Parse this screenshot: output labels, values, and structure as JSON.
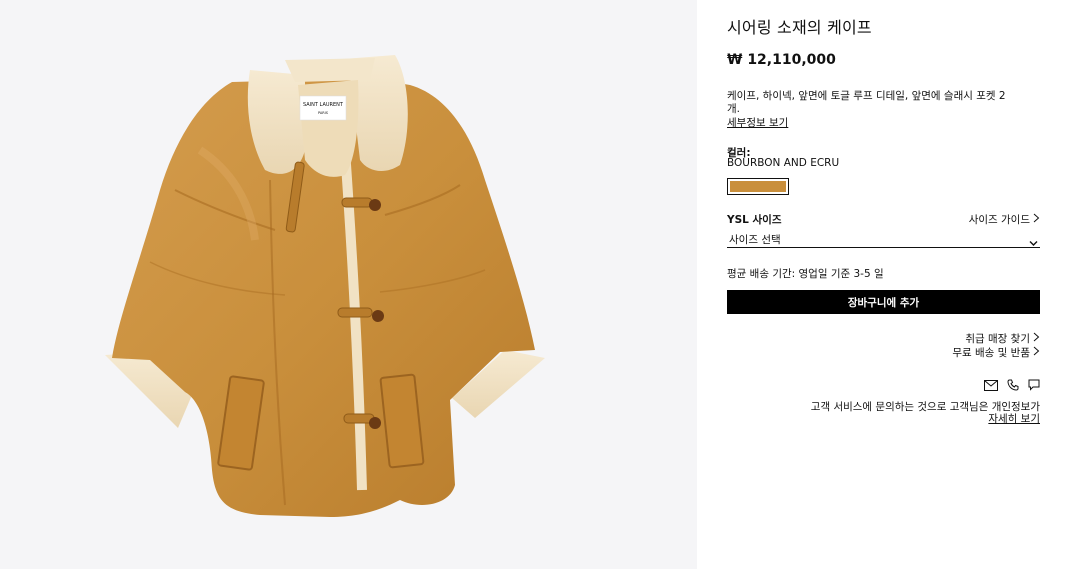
{
  "product": {
    "title": "시어링 소재의 케이프",
    "price": "₩ 12,110,000",
    "description": "케이프, 하이넥, 앞면에 토글 루프 디테일, 앞면에 슬래시 포켓 2개.",
    "detail_link": "세부정보 보기",
    "label_brand": "SAINT LAURENT",
    "label_city": "PARIS"
  },
  "color": {
    "label": "컬러:",
    "value": "BOURBON AND ECRU",
    "swatch_hex": "#c98f3c"
  },
  "size": {
    "label": "YSL 사이즈",
    "guide_label": "사이즈 가이드",
    "select_value": "사이즈 선택"
  },
  "delivery": "평균 배송 기간: 영업일 기준 3-5 일",
  "cart_button": "장바구니에 추가",
  "links": {
    "store": "취급 매장 찾기",
    "shipping": "무료 배송 및 반품"
  },
  "contact": {
    "icons": [
      "mail-icon",
      "phone-icon",
      "chat-icon"
    ],
    "privacy_text": "고객 서비스에 문의하는 것으로 고객님은 개인정보가",
    "privacy_link": "자세히 보기"
  },
  "colors": {
    "leather": "#c98f3c",
    "shearling": "#f1e2c4",
    "accent": "#000000"
  }
}
